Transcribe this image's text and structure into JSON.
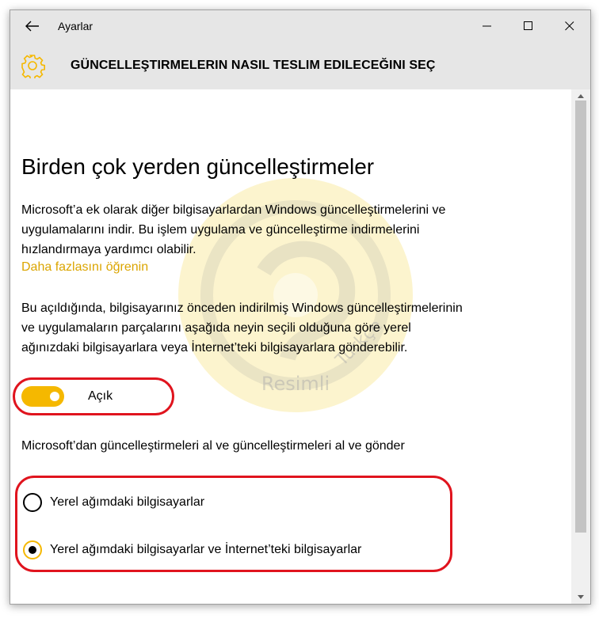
{
  "window": {
    "title": "Ayarlar",
    "header_title": "GÜNCELLEŞTIRMELERIN NASIL TESLIM EDILECEĞINI SEÇ"
  },
  "content": {
    "section_title": "Birden çok yerden güncelleştirmeler",
    "paragraph1": "Microsoft’a ek olarak diğer bilgisayarlardan Windows güncelleştirmelerini ve uygulamalarını indir. Bu işlem uygulama ve güncelleştirme indirmelerini hızlandırmaya yardımcı olabilir.",
    "learn_more_link": "Daha fazlasını öğrenin",
    "paragraph2": "Bu açıldığında, bilgisayarınız önceden indirilmiş Windows güncelleştirmelerinin ve uygulamaların parçalarını aşağıda neyin seçili olduğuna göre yerel ağınızdaki bilgisayarlara veya İnternet’teki bilgisayarlara gönderebilir.",
    "toggle": {
      "label": "Açık",
      "on": true
    },
    "question": "Microsoft’dan güncelleştirmeleri al ve güncelleştirmeleri al ve gönder",
    "radio_options": [
      {
        "label": "Yerel ağımdaki bilgisayarlar",
        "selected": false
      },
      {
        "label": "Yerel ağımdaki bilgisayarlar ve İnternet’teki bilgisayarlar",
        "selected": true
      }
    ]
  },
  "colors": {
    "accent": "#f5b800",
    "link": "#dba500",
    "annotation": "#e0141e",
    "titlebar": "#e6e6e6"
  },
  "watermark": {
    "text_lines": [
      "Resimli",
      "Türkçe"
    ]
  },
  "icons": {
    "back": "back-arrow-icon",
    "minimize": "minimize-icon",
    "maximize": "maximize-icon",
    "close": "close-icon",
    "header": "gear-icon"
  }
}
